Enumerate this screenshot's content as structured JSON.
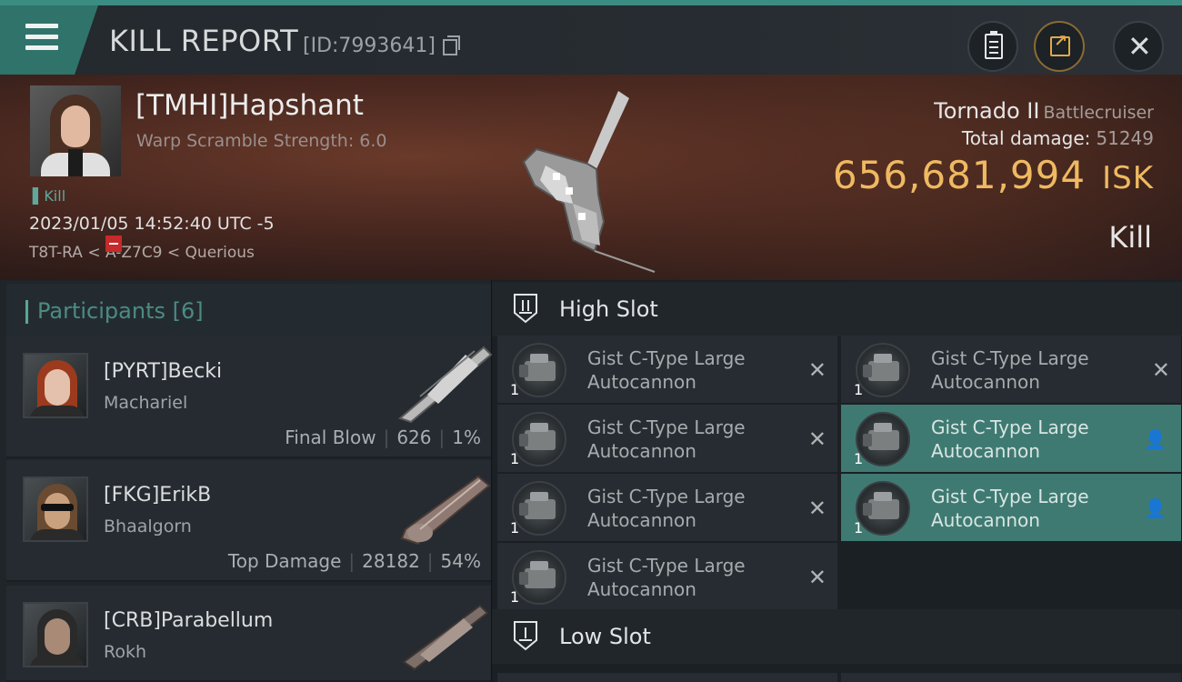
{
  "header": {
    "title": "KILL REPORT",
    "report_id": "[ID:7993641]"
  },
  "victim": {
    "name": "[TMHI]Hapshant",
    "warp": "Warp Scramble Strength: 6.0",
    "tag": "Kill",
    "timestamp": "2023/01/05 14:52:40 UTC -5",
    "location": "T8T-RA < A-Z7C9 < Querious",
    "ship": "Tornado II",
    "ship_class": "Battlecruiser",
    "total_damage_label": "Total damage:",
    "total_damage": "51249",
    "isk_value": "656,681,994",
    "isk_unit": "ISK",
    "report_type": "Kill"
  },
  "participants": {
    "label": "Participants",
    "count": "[6]",
    "items": [
      {
        "name": "[PYRT]Becki",
        "ship": "Machariel",
        "role": "Final Blow",
        "damage": "626",
        "percent": "1%"
      },
      {
        "name": "[FKG]ErikB",
        "ship": "Bhaalgorn",
        "role": "Top Damage",
        "damage": "28182",
        "percent": "54%"
      },
      {
        "name": "[CRB]Parabellum",
        "ship": "Rokh",
        "role": "",
        "damage": "",
        "percent": ""
      }
    ]
  },
  "fitting": {
    "high_slot_label": "High Slot",
    "low_slot_label": "Low Slot",
    "high_slot": [
      {
        "name1": "Gist C-Type Large",
        "name2": "Autocannon",
        "qty": "1",
        "action": "remove"
      },
      {
        "name1": "Gist C-Type Large",
        "name2": "Autocannon",
        "qty": "1",
        "action": "remove"
      },
      {
        "name1": "Gist C-Type Large",
        "name2": "Autocannon",
        "qty": "1",
        "action": "remove"
      },
      {
        "name1": "Gist C-Type Large",
        "name2": "Autocannon",
        "qty": "1",
        "action": "remove"
      },
      {
        "name1": "Gist C-Type Large",
        "name2": "Autocannon",
        "qty": "1",
        "action": "remove"
      },
      {
        "name1": "Gist C-Type Large",
        "name2": "Autocannon",
        "qty": "1",
        "action": "person"
      },
      {
        "name1": "Gist C-Type Large",
        "name2": "Autocannon",
        "qty": "1",
        "action": "person"
      }
    ]
  },
  "colors": {
    "accent": "#3b8c82",
    "isk": "#efb961",
    "selected_module": "#3f7a72"
  },
  "icons": [
    "menu-icon",
    "copy-icon",
    "clipboard-icon",
    "share-icon",
    "close-icon",
    "high-slot-icon",
    "low-slot-icon",
    "autocannon-icon",
    "remove-icon",
    "person-icon"
  ]
}
